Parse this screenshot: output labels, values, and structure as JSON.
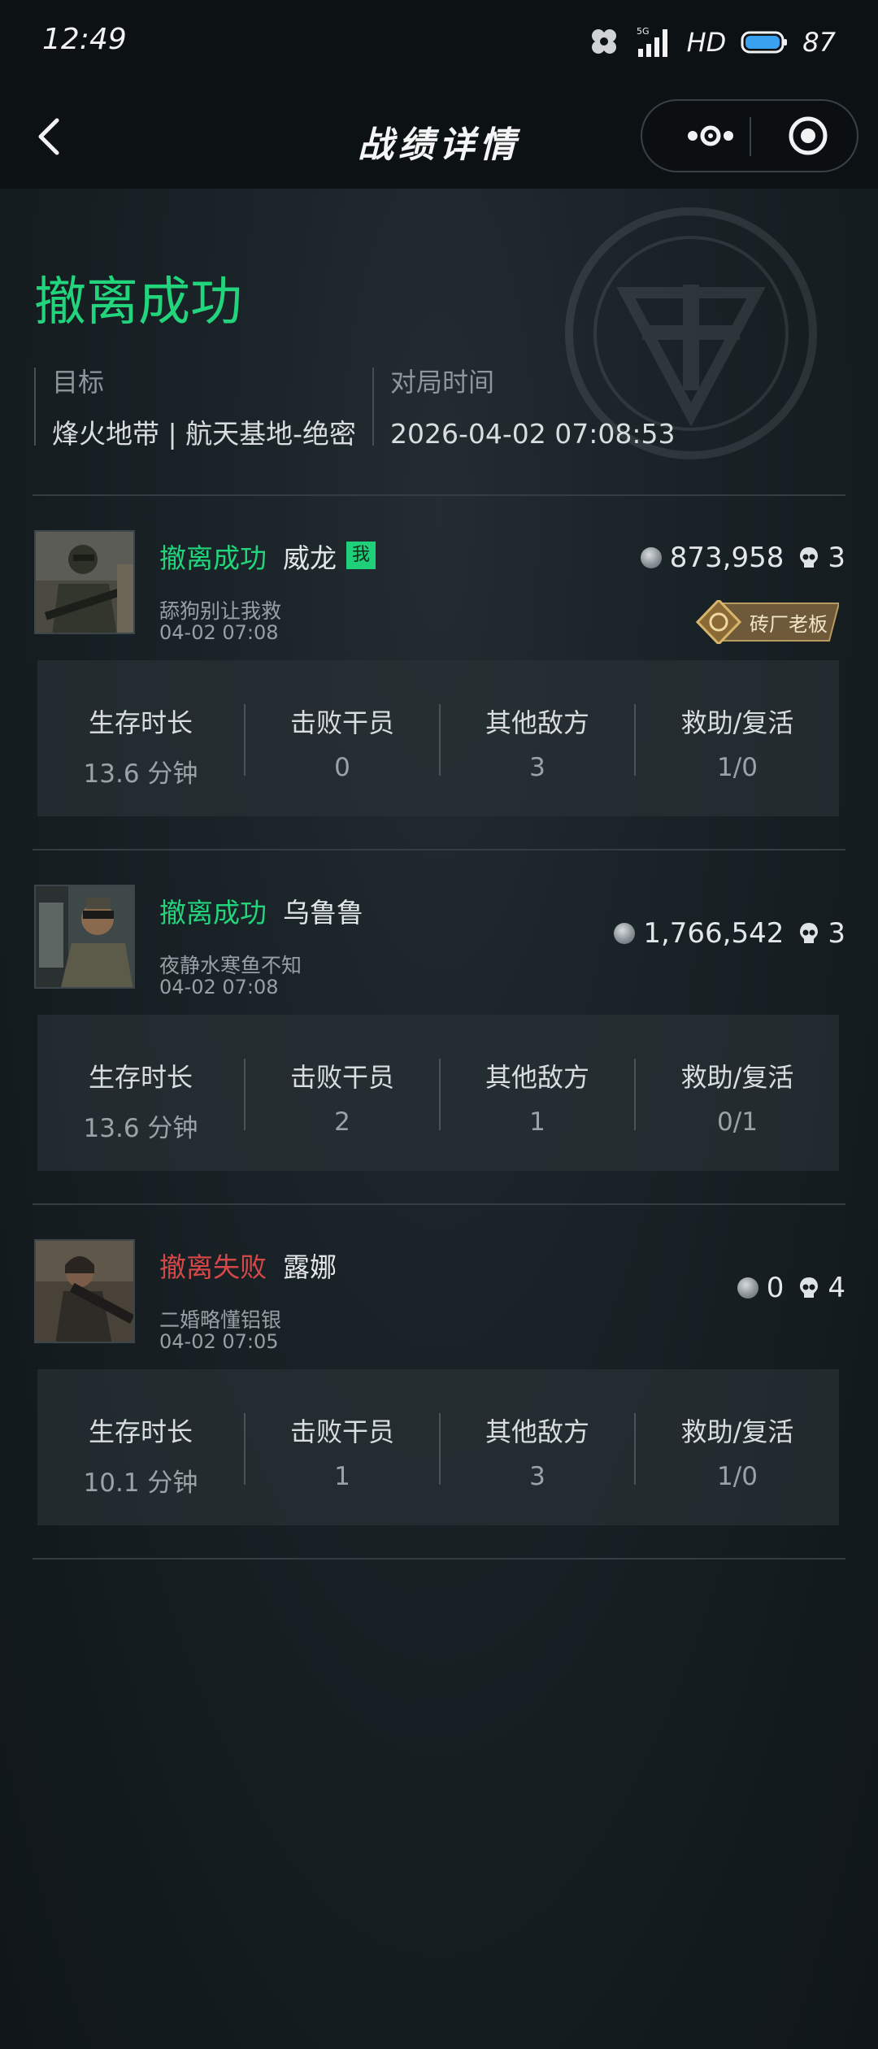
{
  "status_bar": {
    "time": "12:49",
    "signal_label": "5G",
    "hd_label": "HD",
    "battery": "87"
  },
  "nav": {
    "title": "战绩详情"
  },
  "summary": {
    "result": "撤离成功",
    "target_label": "目标",
    "target_value": "烽火地带 | 航天基地-绝密",
    "time_label": "对局时间",
    "time_value": "2026-04-02 07:08:53"
  },
  "stat_labels": {
    "survival": "生存时长",
    "kills": "击败干员",
    "other": "其他敌方",
    "assist": "救助/复活"
  },
  "players": [
    {
      "status": "撤离成功",
      "name": "威龙",
      "me_badge": "我",
      "sub_name": "舔狗别让我救",
      "time": "04-02 07:08",
      "currency": "873,958",
      "kills": "3",
      "rank_badge": "砖厂老板",
      "stats": {
        "survival": "13.6 分钟",
        "kills": "0",
        "other": "3",
        "assist": "1/0"
      }
    },
    {
      "status": "撤离成功",
      "name": "乌鲁鲁",
      "sub_name": "夜静水寒鱼不知",
      "time": "04-02 07:08",
      "currency": "1,766,542",
      "kills": "3",
      "stats": {
        "survival": "13.6 分钟",
        "kills": "2",
        "other": "1",
        "assist": "0/1"
      }
    },
    {
      "status": "撤离失败",
      "name": "露娜",
      "sub_name": "二婚略懂铝银",
      "time": "04-02 07:05",
      "currency": "0",
      "kills": "4",
      "stats": {
        "survival": "10.1 分钟",
        "kills": "1",
        "other": "3",
        "assist": "1/0"
      }
    }
  ],
  "colors": {
    "success": "#22d47c",
    "fail": "#d64848",
    "background": "#13191c"
  }
}
